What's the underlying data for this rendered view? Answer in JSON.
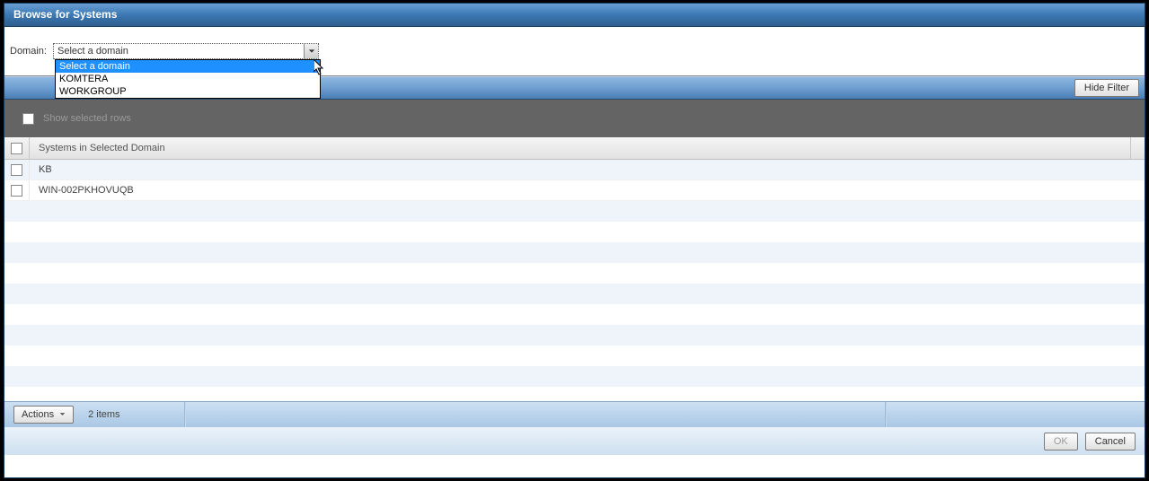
{
  "title": "Browse for Systems",
  "domain_label": "Domain:",
  "domain_select": {
    "current": "Select a domain",
    "options": [
      "Select a domain",
      "KOMTERA",
      "WORKGROUP"
    ]
  },
  "hide_filter_label": "Hide Filter",
  "show_selected_label": "Show selected rows",
  "table": {
    "header": "Systems in Selected Domain",
    "rows": [
      "KB",
      "WIN-002PKHOVUQB"
    ]
  },
  "actions_label": "Actions",
  "item_count": "2 items",
  "ok_label": "OK",
  "cancel_label": "Cancel"
}
